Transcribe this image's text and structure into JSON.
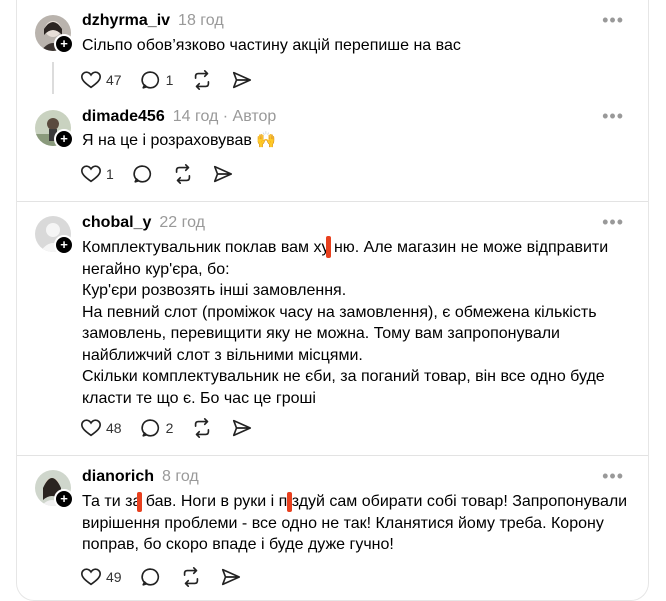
{
  "colors": {
    "redaction": "#e8401e",
    "meta": "#999999",
    "divider": "#e3e3e3"
  },
  "comments": [
    {
      "username": "dzhyrma_iv",
      "time": "18 год",
      "lines": [
        "Сільпо обов’язково частину акцій перепише на вас"
      ],
      "likes": "47",
      "replies": "1",
      "reply": {
        "username": "dimade456",
        "time": "14 год",
        "author_badge": "· Автор",
        "lines": [
          "Я на це і розраховував 🙌"
        ],
        "likes": "1"
      }
    },
    {
      "username": "chobal_y",
      "time": "22 год",
      "lines": [
        "Комплектувальник поклав вам ху ню. Але магазин не може відправити",
        "негайно кур'єра, бо:",
        "Кур'єри розвозять інші замовлення.",
        "На певний слот (проміжок часу на замовлення), є обмежена кількість",
        "замовлень, перевищити яку не можна. Тому вам запропонували",
        "найближчий слот з вільними місцями.",
        "Скільки комплектувальник не єби, за поганий товар, він все одно буде",
        "класти те що є. Бо час це гроші"
      ],
      "likes": "48",
      "replies": "2"
    },
    {
      "username": "dianorich",
      "time": "8 год",
      "lines": [
        "Та ти за бав. Ноги в руки і п здуй сам обирати собі товар! Запропонували",
        "вирішення проблеми - все одно не так! Кланятися йому треба. Корону",
        "поправ, бо скоро впаде і буде дуже гучно!"
      ],
      "likes": "49"
    }
  ],
  "more_label": "•••"
}
